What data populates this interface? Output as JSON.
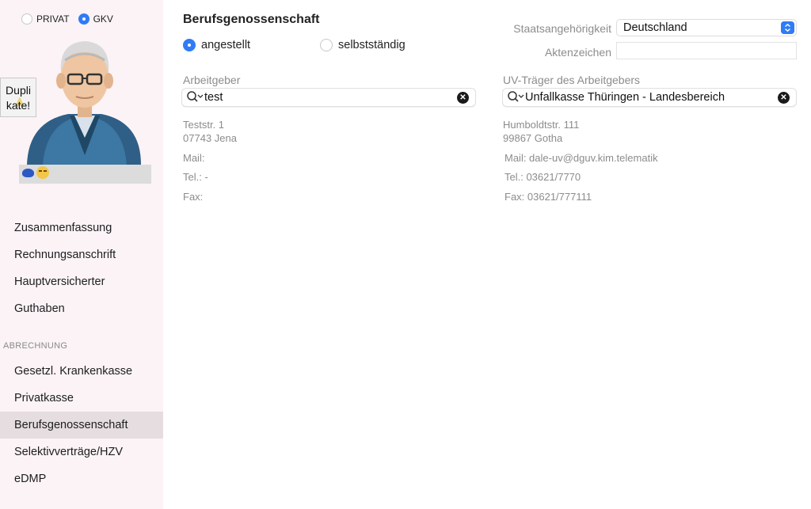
{
  "sidebar": {
    "insurance_options": [
      {
        "label": "PRIVAT",
        "selected": false
      },
      {
        "label": "GKV",
        "selected": true
      }
    ],
    "duplicate_badge": "Dupli\nkate!",
    "items_top": [
      {
        "label": "Zusammenfassung"
      },
      {
        "label": "Rechnungsanschrift"
      },
      {
        "label": "Hauptversicherter"
      },
      {
        "label": "Guthaben"
      }
    ],
    "billing_header": "ABRECHNUNG",
    "items_billing": [
      {
        "label": "Gesetzl. Krankenkasse"
      },
      {
        "label": "Privatkasse"
      },
      {
        "label": "Berufsgenossenschaft",
        "active": true
      },
      {
        "label": "Selektivverträge/HZV"
      },
      {
        "label": "eDMP"
      }
    ]
  },
  "main": {
    "title": "Berufsgenossenschaft",
    "employment": [
      {
        "label": "angestellt",
        "selected": true
      },
      {
        "label": "selbstständig",
        "selected": false
      }
    ],
    "employer": {
      "label": "Arbeitgeber",
      "search_value": "test",
      "street": "Teststr. 1",
      "city": "07743 Jena",
      "mail": "Mail:",
      "tel": "Tel.: -",
      "fax": "Fax:"
    },
    "nationality": {
      "label": "Staatsangehörigkeit",
      "value": "Deutschland"
    },
    "file_number": {
      "label": "Aktenzeichen",
      "value": ""
    },
    "uv_carrier": {
      "label": "UV-Träger des Arbeitgebers",
      "search_value": "Unfallkasse Thüringen - Landesbereich",
      "street": "Humboldtstr. 111",
      "city": "99867 Gotha",
      "mail": "Mail: dale-uv@dguv.kim.telematik",
      "tel": "Tel.: 03621/7770",
      "fax": "Fax: 03621/777111"
    }
  },
  "colors": {
    "accent": "#2f7cf6",
    "sidebar_bg": "#fbf3f6",
    "active_item": "#e5dde0"
  },
  "icons": [
    "search-icon",
    "clear-icon",
    "popup-stepper-icon",
    "warning-icon"
  ]
}
